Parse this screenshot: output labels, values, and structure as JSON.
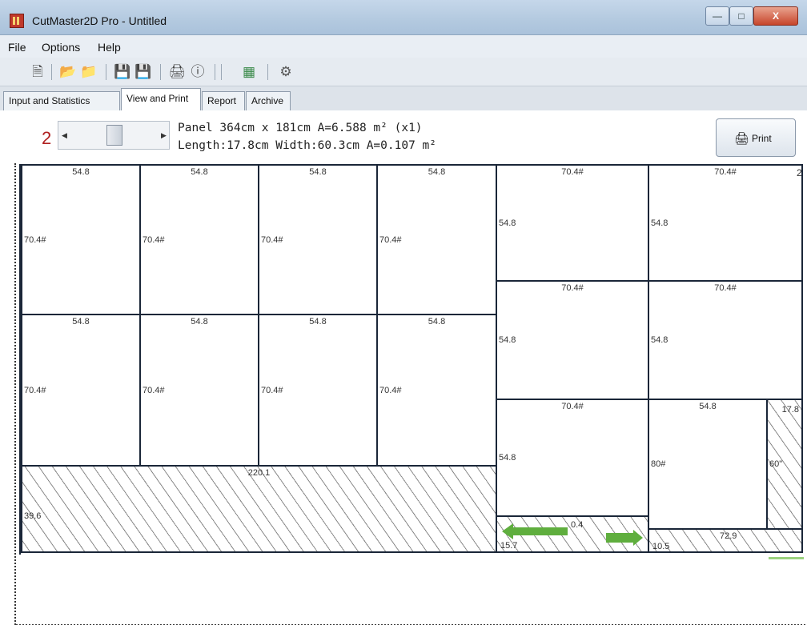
{
  "window": {
    "title": "CutMaster2D Pro - Untitled",
    "min_glyph": "—",
    "max_glyph": "□",
    "close_glyph": "X"
  },
  "menu": [
    "File",
    "Options",
    "Help"
  ],
  "toolbar": {
    "icons": [
      "new-file-icon",
      "open-folder-icon",
      "open-folder-alt-icon",
      "save-icon",
      "save-as-icon",
      "print-preview-icon",
      "info-icon",
      "layout-icon",
      "settings-icon"
    ]
  },
  "tabs": [
    "Input and Statistics",
    "View and Print",
    "Report",
    "Archive"
  ],
  "active_tab": "View and Print",
  "view": {
    "sheet_number": "2",
    "panel_info": "Panel 364cm x 181cm A=6.588 m² (x1)",
    "piece_info": "Length:17.8cm Width:60.3cm A=0.107 m²",
    "print_label": "Print"
  },
  "layout": {
    "labels": {
      "w548": "54.8",
      "h704": "70.4#",
      "waste_main_top": "220.1",
      "waste_main_left": "39.6",
      "waste_small_right": "17.8",
      "waste_small_right_left": "60\"",
      "piece_80": "80#",
      "waste_strip_a_top": "0.4",
      "waste_strip_a_left": "15.7",
      "waste_strip_b_top": "72.9",
      "waste_strip_b_left": "10.5",
      "edge_mark": "2"
    }
  },
  "colors": {
    "sheet_number": "#b02020",
    "piece_border": "#1a2638",
    "selected_border": "#a3412d",
    "arrow_green": "#5fae3e"
  }
}
